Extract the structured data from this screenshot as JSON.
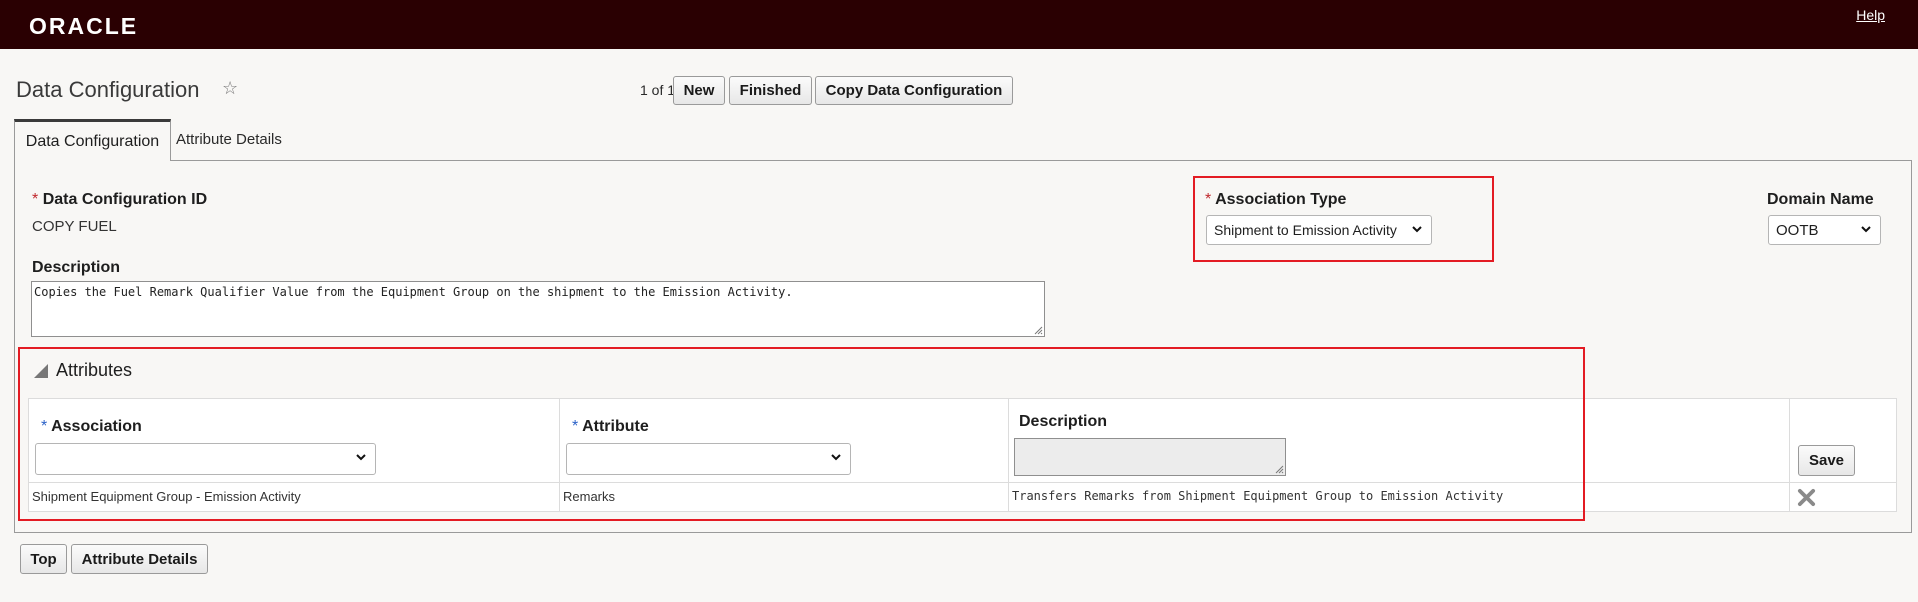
{
  "header": {
    "logo": "ORACLE",
    "help": "Help"
  },
  "page": {
    "title": "Data Configuration",
    "pager": "1 of 1",
    "buttons": {
      "new": "New",
      "finished": "Finished",
      "copy": "Copy Data Configuration"
    }
  },
  "tabs": [
    {
      "label": "Data Configuration",
      "active": true
    },
    {
      "label": "Attribute Details",
      "active": false
    }
  ],
  "form": {
    "config_id_label": "Data Configuration ID",
    "config_id_value": "COPY FUEL",
    "association_type_label": "Association Type",
    "association_type_value": "Shipment to Emission Activity",
    "domain_name_label": "Domain Name",
    "domain_name_value": "OOTB",
    "description_label": "Description",
    "description_value": "Copies the Fuel Remark Qualifier Value from the Equipment Group on the shipment to the Emission Activity.",
    "required_mark": "*"
  },
  "attributes": {
    "title": "Attributes",
    "columns": {
      "association": "Association",
      "attribute": "Attribute",
      "description": "Description"
    },
    "save_label": "Save",
    "rows": [
      {
        "association": "Shipment Equipment Group - Emission Activity",
        "attribute": "Remarks",
        "description": "Transfers Remarks from Shipment Equipment Group to Emission Activity"
      }
    ]
  },
  "footer": {
    "top": "Top",
    "attribute_details": "Attribute Details"
  },
  "colors": {
    "header_bg": "#2a0002",
    "highlight": "#e31b23",
    "required_red": "#c0282d",
    "required_blue": "#2b62c8"
  }
}
